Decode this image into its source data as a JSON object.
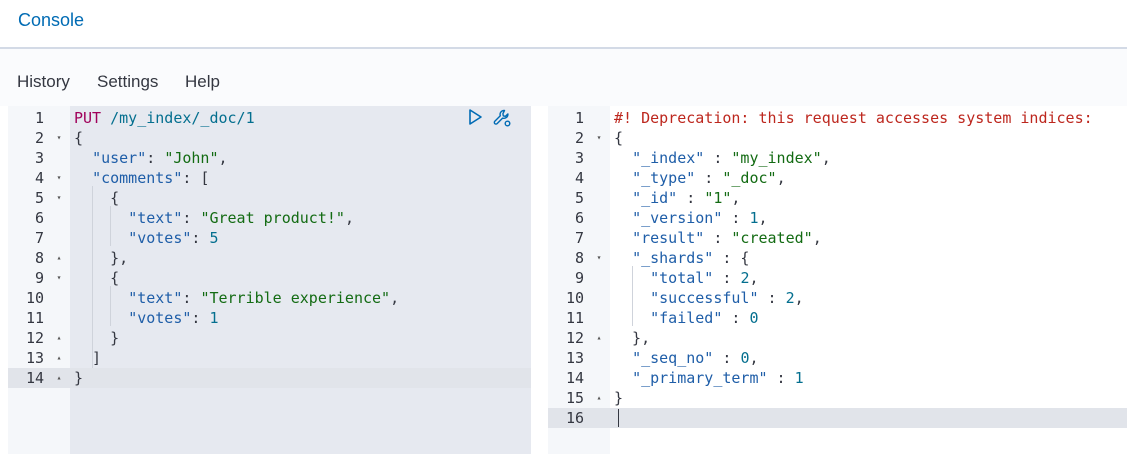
{
  "tabs": [
    {
      "label": "Console",
      "active": true
    }
  ],
  "menu": {
    "history": "History",
    "settings": "Settings",
    "help": "Help"
  },
  "colors": {
    "accent": "#006bb4",
    "method": "#a0005a",
    "string": "#136b13",
    "key": "#1f5ea8",
    "comment": "#bd271e"
  },
  "request_editor": {
    "actions": [
      {
        "icon": "play-icon",
        "label": "Send request"
      },
      {
        "icon": "wrench-icon",
        "label": "Settings"
      }
    ],
    "lines": [
      {
        "n": "1",
        "fold": "",
        "tokens": [
          {
            "t": "PUT",
            "c": "method"
          },
          {
            "t": " /my_index/_doc/1",
            "c": "url"
          }
        ]
      },
      {
        "n": "2",
        "fold": "open",
        "tokens": [
          {
            "t": "{",
            "c": "punct"
          }
        ]
      },
      {
        "n": "3",
        "fold": "",
        "tokens": [
          {
            "t": "  ",
            "c": "punct"
          },
          {
            "t": "\"user\"",
            "c": "key"
          },
          {
            "t": ": ",
            "c": "punct"
          },
          {
            "t": "\"John\"",
            "c": "str"
          },
          {
            "t": ",",
            "c": "punct"
          }
        ]
      },
      {
        "n": "4",
        "fold": "open",
        "tokens": [
          {
            "t": "  ",
            "c": "punct"
          },
          {
            "t": "\"comments\"",
            "c": "key"
          },
          {
            "t": ": [",
            "c": "punct"
          }
        ]
      },
      {
        "n": "5",
        "fold": "open",
        "tokens": [
          {
            "t": "    {",
            "c": "punct"
          }
        ]
      },
      {
        "n": "6",
        "fold": "",
        "tokens": [
          {
            "t": "      ",
            "c": "punct"
          },
          {
            "t": "\"text\"",
            "c": "key"
          },
          {
            "t": ": ",
            "c": "punct"
          },
          {
            "t": "\"Great product!\"",
            "c": "str"
          },
          {
            "t": ",",
            "c": "punct"
          }
        ]
      },
      {
        "n": "7",
        "fold": "",
        "tokens": [
          {
            "t": "      ",
            "c": "punct"
          },
          {
            "t": "\"votes\"",
            "c": "key"
          },
          {
            "t": ": ",
            "c": "punct"
          },
          {
            "t": "5",
            "c": "num"
          }
        ]
      },
      {
        "n": "8",
        "fold": "close",
        "tokens": [
          {
            "t": "    },",
            "c": "punct"
          }
        ]
      },
      {
        "n": "9",
        "fold": "open",
        "tokens": [
          {
            "t": "    {",
            "c": "punct"
          }
        ]
      },
      {
        "n": "10",
        "fold": "",
        "tokens": [
          {
            "t": "      ",
            "c": "punct"
          },
          {
            "t": "\"text\"",
            "c": "key"
          },
          {
            "t": ": ",
            "c": "punct"
          },
          {
            "t": "\"Terrible experience\"",
            "c": "str"
          },
          {
            "t": ",",
            "c": "punct"
          }
        ]
      },
      {
        "n": "11",
        "fold": "",
        "tokens": [
          {
            "t": "      ",
            "c": "punct"
          },
          {
            "t": "\"votes\"",
            "c": "key"
          },
          {
            "t": ": ",
            "c": "punct"
          },
          {
            "t": "1",
            "c": "num"
          }
        ]
      },
      {
        "n": "12",
        "fold": "close",
        "tokens": [
          {
            "t": "    }",
            "c": "punct"
          }
        ]
      },
      {
        "n": "13",
        "fold": "close",
        "tokens": [
          {
            "t": "  ]",
            "c": "punct"
          }
        ]
      },
      {
        "n": "14",
        "fold": "close",
        "tokens": [
          {
            "t": "}",
            "c": "punct"
          }
        ],
        "active": true
      }
    ]
  },
  "response_editor": {
    "lines": [
      {
        "n": "1",
        "fold": "",
        "tokens": [
          {
            "t": "#! Deprecation: this request accesses system indices:",
            "c": "comment"
          }
        ]
      },
      {
        "n": "2",
        "fold": "open",
        "tokens": [
          {
            "t": "{",
            "c": "punct"
          }
        ]
      },
      {
        "n": "3",
        "fold": "",
        "tokens": [
          {
            "t": "  ",
            "c": "punct"
          },
          {
            "t": "\"_index\"",
            "c": "key"
          },
          {
            "t": " : ",
            "c": "punct"
          },
          {
            "t": "\"my_index\"",
            "c": "str"
          },
          {
            "t": ",",
            "c": "punct"
          }
        ]
      },
      {
        "n": "4",
        "fold": "",
        "tokens": [
          {
            "t": "  ",
            "c": "punct"
          },
          {
            "t": "\"_type\"",
            "c": "key"
          },
          {
            "t": " : ",
            "c": "punct"
          },
          {
            "t": "\"_doc\"",
            "c": "str"
          },
          {
            "t": ",",
            "c": "punct"
          }
        ]
      },
      {
        "n": "5",
        "fold": "",
        "tokens": [
          {
            "t": "  ",
            "c": "punct"
          },
          {
            "t": "\"_id\"",
            "c": "key"
          },
          {
            "t": " : ",
            "c": "punct"
          },
          {
            "t": "\"1\"",
            "c": "str"
          },
          {
            "t": ",",
            "c": "punct"
          }
        ]
      },
      {
        "n": "6",
        "fold": "",
        "tokens": [
          {
            "t": "  ",
            "c": "punct"
          },
          {
            "t": "\"_version\"",
            "c": "key"
          },
          {
            "t": " : ",
            "c": "punct"
          },
          {
            "t": "1",
            "c": "num"
          },
          {
            "t": ",",
            "c": "punct"
          }
        ]
      },
      {
        "n": "7",
        "fold": "",
        "tokens": [
          {
            "t": "  ",
            "c": "punct"
          },
          {
            "t": "\"result\"",
            "c": "key"
          },
          {
            "t": " : ",
            "c": "punct"
          },
          {
            "t": "\"created\"",
            "c": "str"
          },
          {
            "t": ",",
            "c": "punct"
          }
        ]
      },
      {
        "n": "8",
        "fold": "open",
        "tokens": [
          {
            "t": "  ",
            "c": "punct"
          },
          {
            "t": "\"_shards\"",
            "c": "key"
          },
          {
            "t": " : {",
            "c": "punct"
          }
        ]
      },
      {
        "n": "9",
        "fold": "",
        "tokens": [
          {
            "t": "    ",
            "c": "punct"
          },
          {
            "t": "\"total\"",
            "c": "key"
          },
          {
            "t": " : ",
            "c": "punct"
          },
          {
            "t": "2",
            "c": "num"
          },
          {
            "t": ",",
            "c": "punct"
          }
        ]
      },
      {
        "n": "10",
        "fold": "",
        "tokens": [
          {
            "t": "    ",
            "c": "punct"
          },
          {
            "t": "\"successful\"",
            "c": "key"
          },
          {
            "t": " : ",
            "c": "punct"
          },
          {
            "t": "2",
            "c": "num"
          },
          {
            "t": ",",
            "c": "punct"
          }
        ]
      },
      {
        "n": "11",
        "fold": "",
        "tokens": [
          {
            "t": "    ",
            "c": "punct"
          },
          {
            "t": "\"failed\"",
            "c": "key"
          },
          {
            "t": " : ",
            "c": "punct"
          },
          {
            "t": "0",
            "c": "num"
          }
        ]
      },
      {
        "n": "12",
        "fold": "close",
        "tokens": [
          {
            "t": "  },",
            "c": "punct"
          }
        ]
      },
      {
        "n": "13",
        "fold": "",
        "tokens": [
          {
            "t": "  ",
            "c": "punct"
          },
          {
            "t": "\"_seq_no\"",
            "c": "key"
          },
          {
            "t": " : ",
            "c": "punct"
          },
          {
            "t": "0",
            "c": "num"
          },
          {
            "t": ",",
            "c": "punct"
          }
        ]
      },
      {
        "n": "14",
        "fold": "",
        "tokens": [
          {
            "t": "  ",
            "c": "punct"
          },
          {
            "t": "\"_primary_term\"",
            "c": "key"
          },
          {
            "t": " : ",
            "c": "punct"
          },
          {
            "t": "1",
            "c": "num"
          }
        ]
      },
      {
        "n": "15",
        "fold": "close",
        "tokens": [
          {
            "t": "}",
            "c": "punct"
          }
        ]
      },
      {
        "n": "16",
        "fold": "",
        "tokens": [],
        "active": true
      }
    ]
  }
}
